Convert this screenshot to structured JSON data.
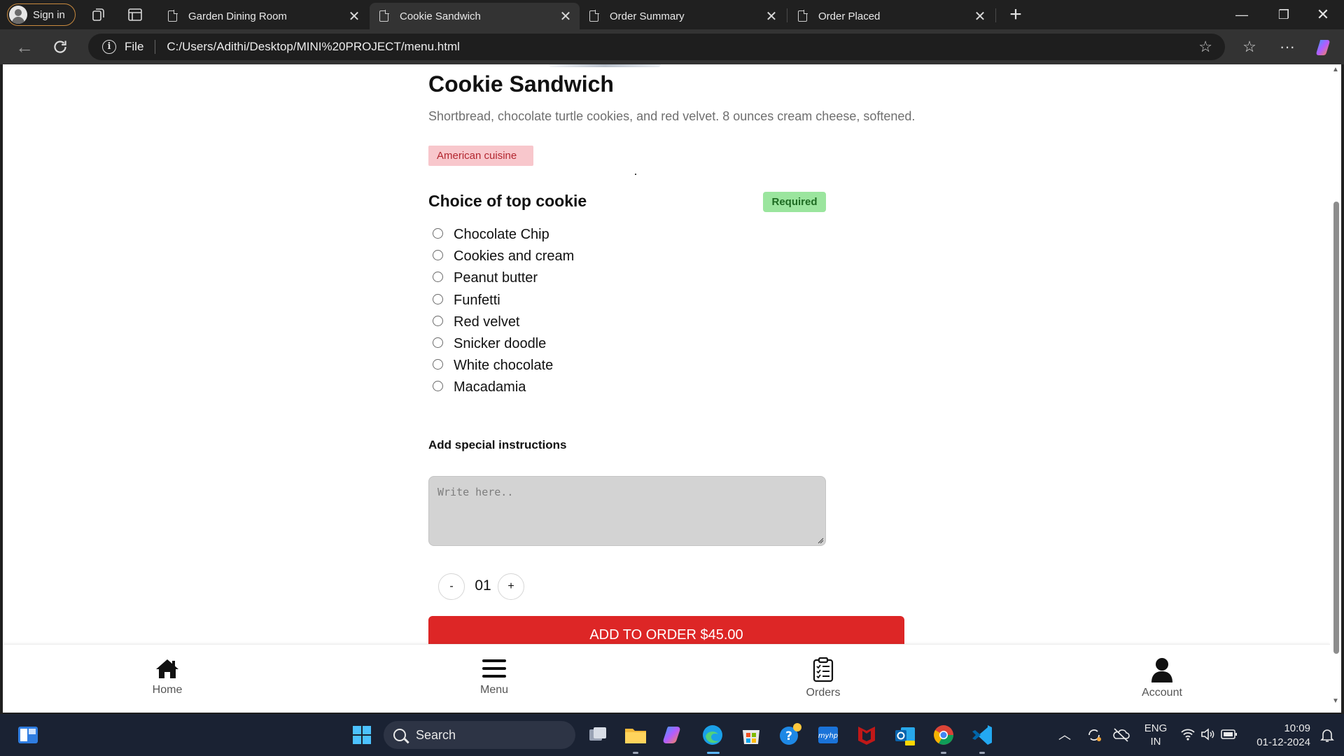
{
  "browser": {
    "signin_label": "Sign in",
    "tabs": [
      {
        "title": "Garden Dining Room"
      },
      {
        "title": "Cookie Sandwich"
      },
      {
        "title": "Order Summary"
      },
      {
        "title": "Order Placed"
      }
    ],
    "address": {
      "scheme_label": "File",
      "url": "C:/Users/Adithi/Desktop/MINI%20PROJECT/menu.html"
    }
  },
  "page": {
    "dish_title": "Cookie Sandwich",
    "dish_description": "Shortbread, chocolate turtle cookies, and red velvet. 8 ounces cream cheese, softened.",
    "cuisine_tag": "American cuisine",
    "choice_title": "Choice of top cookie",
    "required_badge": "Required",
    "options": [
      "Chocolate Chip",
      "Cookies and cream",
      "Peanut butter",
      "Funfetti",
      "Red velvet",
      "Snicker doodle",
      "White chocolate",
      "Macadamia"
    ],
    "instructions_title": "Add special instructions",
    "instructions_placeholder": "Write here..",
    "qty_minus": "-",
    "qty_value": "01",
    "qty_plus": "+",
    "add_button": "ADD TO ORDER $45.00"
  },
  "bottom_nav": {
    "home": "Home",
    "menu": "Menu",
    "orders": "Orders",
    "account": "Account"
  },
  "taskbar": {
    "search_label": "Search",
    "lang_line1": "ENG",
    "lang_line2": "IN",
    "time": "10:09",
    "date": "01-12-2024"
  },
  "colors": {
    "accent_red": "#dd2626",
    "required_green": "#9be59e",
    "cuisine_pink": "#f8c7cc"
  }
}
